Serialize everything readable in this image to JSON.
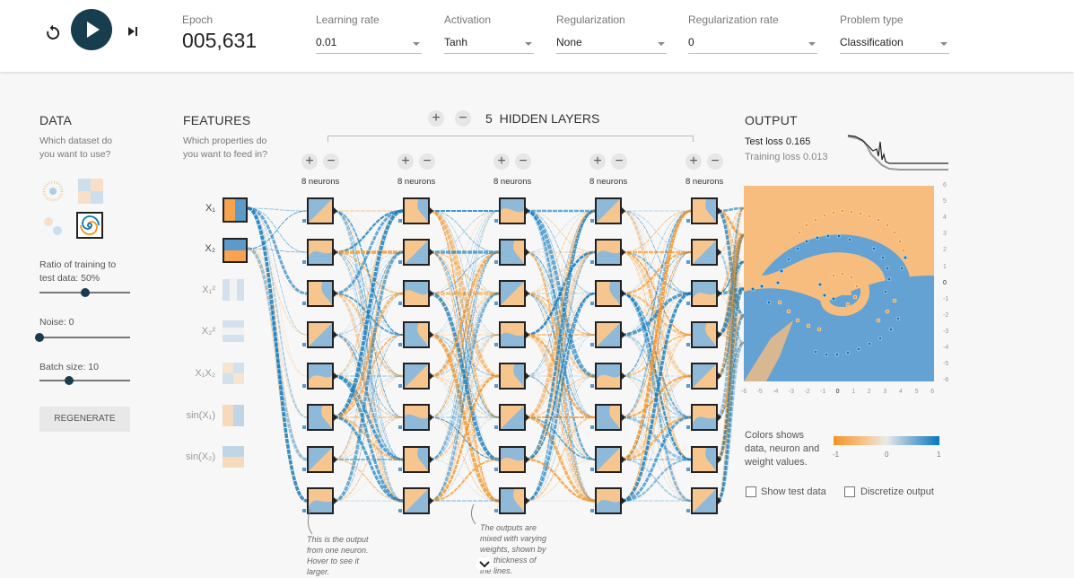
{
  "topbar": {
    "epoch_label": "Epoch",
    "epoch_value": "005,631",
    "learning_rate": {
      "label": "Learning rate",
      "value": "0.01"
    },
    "activation": {
      "label": "Activation",
      "value": "Tanh"
    },
    "regularization": {
      "label": "Regularization",
      "value": "None"
    },
    "regularization_rate": {
      "label": "Regularization rate",
      "value": "0"
    },
    "problem_type": {
      "label": "Problem type",
      "value": "Classification"
    }
  },
  "data_section": {
    "title": "DATA",
    "subtitle_line1": "Which dataset do",
    "subtitle_line2": "you want to use?",
    "ratio_label_line1": "Ratio of training to",
    "ratio_label_line2": "test data:  50%",
    "ratio_fraction": 0.5,
    "noise_label": "Noise:  0",
    "noise_fraction": 0.0,
    "batch_label": "Batch size:  10",
    "batch_fraction": 0.33,
    "regenerate": "REGENERATE"
  },
  "features": {
    "title": "FEATURES",
    "subtitle_line1": "Which properties do",
    "subtitle_line2": "you want to feed in?",
    "items": [
      {
        "label": "X₁",
        "active": true
      },
      {
        "label": "X₂",
        "active": true
      },
      {
        "label": "X₁²",
        "active": false
      },
      {
        "label": "X₂²",
        "active": false
      },
      {
        "label": "X₁X₂",
        "active": false
      },
      {
        "label": "sin(X₁)",
        "active": false
      },
      {
        "label": "sin(X₂)",
        "active": false
      }
    ]
  },
  "network": {
    "hidden_layers_count": "5",
    "hidden_layers_label": "HIDDEN LAYERS",
    "plus": "+",
    "minus": "−",
    "layers": [
      {
        "neurons_label": "8 neurons"
      },
      {
        "neurons_label": "8 neurons"
      },
      {
        "neurons_label": "8 neurons"
      },
      {
        "neurons_label": "8 neurons"
      },
      {
        "neurons_label": "8 neurons"
      }
    ],
    "note1": [
      "This is the output",
      "from one neuron.",
      "Hover to see it",
      "larger."
    ],
    "note2": [
      "The outputs are",
      "mixed with varying",
      "weights, shown by",
      "the thickness of",
      "the lines."
    ]
  },
  "output": {
    "title": "OUTPUT",
    "test_loss_label": "Test loss",
    "test_loss_value": "0.165",
    "train_loss_label": "Training loss",
    "train_loss_value": "0.013",
    "x_ticks": [
      "-6",
      "-5",
      "-4",
      "-3",
      "-2",
      "-1",
      "0",
      "1",
      "2",
      "3",
      "4",
      "5",
      "6"
    ],
    "y_ticks": [
      "6",
      "5",
      "4",
      "3",
      "2",
      "1",
      "0",
      "-1",
      "-2",
      "-3",
      "-4",
      "-5",
      "-6"
    ],
    "colors_text_line1": "Colors shows",
    "colors_text_line2": "data, neuron and",
    "colors_text_line3": "weight values.",
    "legend_ticks": [
      "-1",
      "0",
      "1"
    ],
    "show_test_data": "Show test data",
    "discretize_output": "Discretize output"
  },
  "colors": {
    "orange": "#f59322",
    "blue": "#0877bd",
    "dark_button": "#183d4e"
  }
}
